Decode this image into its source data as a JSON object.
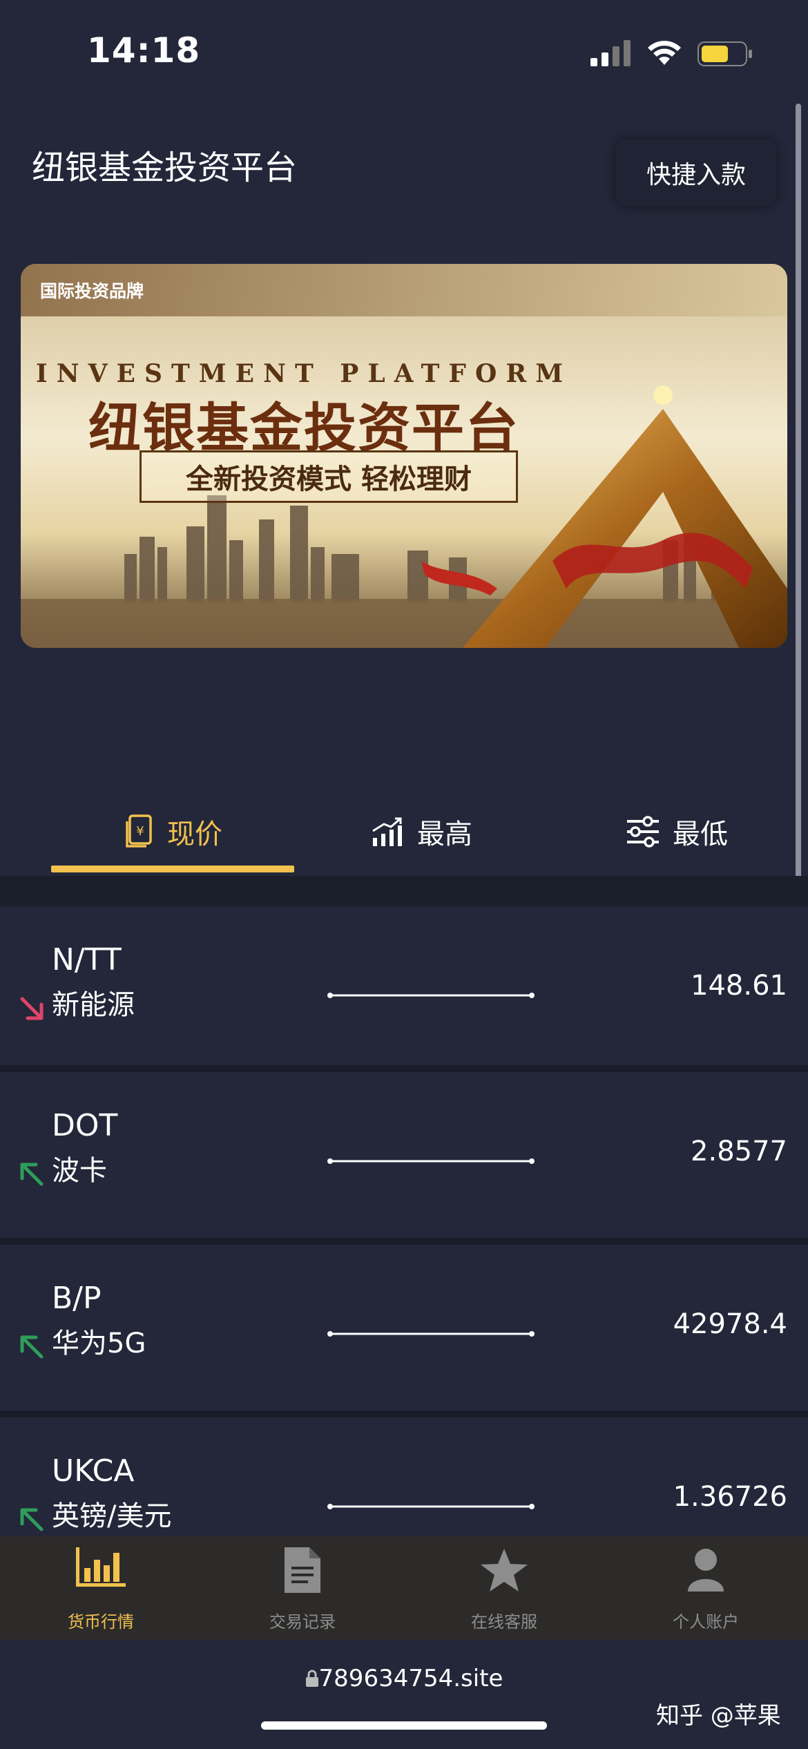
{
  "status_bar": {
    "time": "14:18"
  },
  "header": {
    "title": "纽银基金投资平台",
    "quick_deposit_label": "快捷入款"
  },
  "banner": {
    "tag": "国际投资品牌",
    "headline_en": "INVESTMENT PLATFORM",
    "headline_cn": "纽银基金投资平台",
    "slogan": "全新投资模式 轻松理财"
  },
  "tabs": [
    {
      "label": "现价",
      "icon": "receipt-yen-icon",
      "active": true
    },
    {
      "label": "最高",
      "icon": "trend-up-icon",
      "active": false
    },
    {
      "label": "最低",
      "icon": "sliders-icon",
      "active": false
    }
  ],
  "markets": [
    {
      "symbol": "N/TT",
      "name": "新能源",
      "price": "148.61",
      "trend": "down"
    },
    {
      "symbol": "DOT",
      "name": "波卡",
      "price": "2.8577",
      "trend": "up"
    },
    {
      "symbol": "B/P",
      "name": "华为5G",
      "price": "42978.4",
      "trend": "up"
    },
    {
      "symbol": "UKCA",
      "name": "英镑/美元",
      "price": "1.36726",
      "trend": "up"
    }
  ],
  "bottom_nav": [
    {
      "label": "货币行情",
      "icon": "bar-chart-icon",
      "active": true
    },
    {
      "label": "交易记录",
      "icon": "document-icon",
      "active": false
    },
    {
      "label": "在线客服",
      "icon": "star-icon",
      "active": false
    },
    {
      "label": "个人账户",
      "icon": "person-icon",
      "active": false
    }
  ],
  "browser": {
    "url": "789634754.site"
  },
  "watermark": "知乎 @苹果",
  "colors": {
    "accent": "#f2c14e",
    "background": "#232739",
    "down": "#e0446a",
    "up": "#2f9d5a"
  }
}
